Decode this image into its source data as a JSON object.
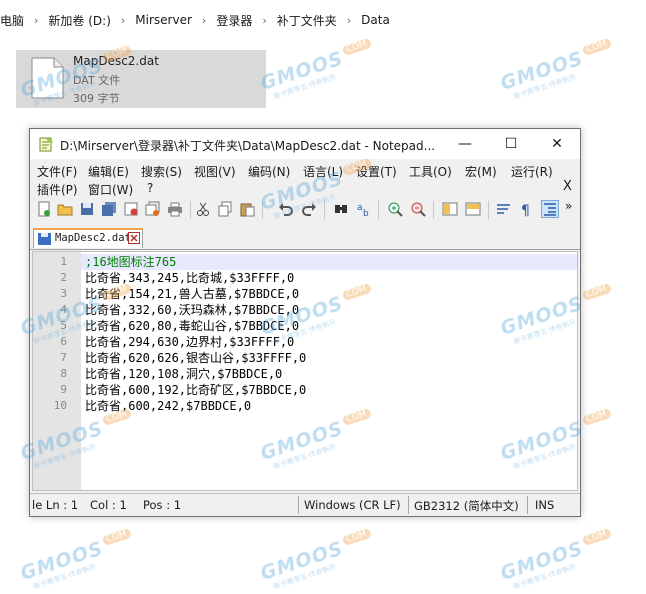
{
  "explorer": {
    "breadcrumb": [
      "电脑",
      "新加卷 (D:)",
      "Mirserver",
      "登录器",
      "补丁文件夹",
      "Data"
    ],
    "file": {
      "name": "MapDesc2.dat",
      "type": "DAT 文件",
      "size": "309 字节"
    }
  },
  "window": {
    "title": "D:\\Mirserver\\登录器\\补丁文件夹\\Data\\MapDesc2.dat - Notepad...",
    "buttons": {
      "minimize": "—",
      "maximize": "☐",
      "close": "✕"
    }
  },
  "menu": {
    "row1": [
      "文件(F)",
      "编辑(E)",
      "搜索(S)",
      "视图(V)",
      "编码(N)",
      "语言(L)",
      "设置(T)",
      "工具(O)",
      "宏(M)",
      "运行(R)"
    ],
    "row2": [
      "插件(P)",
      "窗口(W)",
      "?"
    ],
    "doc_close": "X"
  },
  "toolbar": {
    "icons": [
      "new-file-icon",
      "open-file-icon",
      "save-icon",
      "save-all-icon",
      "close-icon",
      "close-all-icon",
      "print-icon",
      "cut-icon",
      "copy-icon",
      "paste-icon",
      "undo-icon",
      "redo-icon",
      "find-icon",
      "replace-icon",
      "zoom-in-icon",
      "zoom-out-icon",
      "sync-vertical-icon",
      "sync-horizontal-icon",
      "word-wrap-icon",
      "show-all-chars-icon",
      "indent-guide-icon"
    ],
    "overflow": "»"
  },
  "tab": {
    "label": "MapDesc2.dat"
  },
  "editor": {
    "line_numbers": [
      "1",
      "2",
      "3",
      "4",
      "5",
      "6",
      "7",
      "8",
      "9",
      "10"
    ],
    "lines": [
      ";16地图标注765",
      "比奇省,343,245,比奇城,$33FFFF,0",
      "比奇省,154,21,兽人古墓,$7BBDCE,0",
      "比奇省,332,60,沃玛森林,$7BBDCE,0",
      "比奇省,620,80,毒蛇山谷,$7BBDCE,0",
      "比奇省,294,630,边界村,$33FFFF,0",
      "比奇省,620,626,银杏山谷,$33FFFF,0",
      "比奇省,120,108,洞穴,$7BBDCE,0",
      "比奇省,600,192,比奇矿区,$7BBDCE,0",
      "比奇省,600,242,$7BBDCE,0"
    ]
  },
  "status": {
    "position": "le Ln : 1",
    "col": "Col : 1",
    "pos": "Pos : 1",
    "eol": "Windows (CR LF)",
    "encoding": "GB2312 (简体中文)",
    "mode": "INS"
  },
  "watermark": {
    "brand": "GMOOS",
    "badge": "COM",
    "tagline": "斯卡赛零五·传奇新开"
  }
}
